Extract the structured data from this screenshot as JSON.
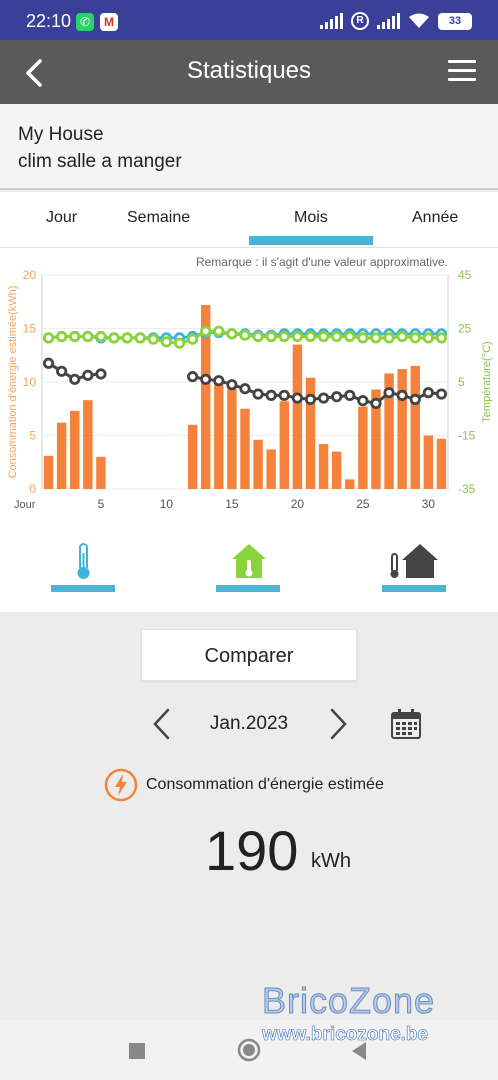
{
  "status_bar": {
    "time": "22:10",
    "battery": "33",
    "apps": [
      "whatsapp-icon",
      "gmail-icon"
    ],
    "indicators": [
      "signal-icon",
      "roaming-icon",
      "signal-icon",
      "wifi-icon",
      "battery-icon"
    ]
  },
  "app_bar": {
    "title": "Statistiques",
    "back_icon": "back-arrow-icon",
    "menu_icon": "hamburger-menu-icon"
  },
  "device": {
    "home": "My House",
    "name": "clim salle a manger"
  },
  "tabs": [
    {
      "label": "Jour",
      "active": false
    },
    {
      "label": "Semaine",
      "active": false
    },
    {
      "label": "Mois",
      "active": true
    },
    {
      "label": "Année",
      "active": false
    }
  ],
  "chart_data": {
    "type": "bar",
    "note": "Remarque : il s'agit d'une valeur approximative.",
    "xlabel": "Jour",
    "ylabel": "Consommation d'énergie estimée(kWh)",
    "y2label": "Température(°C)",
    "ylim": [
      0,
      20
    ],
    "y2lim": [
      -35,
      45
    ],
    "x": [
      1,
      2,
      3,
      4,
      5,
      6,
      7,
      8,
      9,
      10,
      11,
      12,
      13,
      14,
      15,
      16,
      17,
      18,
      19,
      20,
      21,
      22,
      23,
      24,
      25,
      26,
      27,
      28,
      29,
      30,
      31
    ],
    "xticks": [
      5,
      10,
      15,
      20,
      25,
      30
    ],
    "yticks": [
      0,
      5,
      10,
      15,
      20
    ],
    "y2ticks": [
      -35,
      -15,
      5,
      25,
      45
    ],
    "colors": {
      "bars": "#f5823a",
      "axis_left": "#f5a35f",
      "axis_right": "#8bc34a",
      "series_blue": "#3fb3d9",
      "series_green": "#8bd33a",
      "series_dark": "#444444"
    },
    "series": [
      {
        "type": "bar",
        "values": [
          3.1,
          6.2,
          7.3,
          8.3,
          3.0,
          null,
          null,
          null,
          null,
          null,
          null,
          6.0,
          17.2,
          10.3,
          9.4,
          7.5,
          4.6,
          3.7,
          8.2,
          13.5,
          10.4,
          4.2,
          3.5,
          0.9,
          7.7,
          9.3,
          10.8,
          11.2,
          11.5,
          5.0,
          4.7
        ]
      },
      {
        "type": "line",
        "values": [
          21.5,
          22,
          22,
          22,
          21.5,
          21.5,
          21.5,
          21.5,
          21.5,
          21.5,
          21.5,
          22,
          23.5,
          23.5,
          23,
          23,
          22.5,
          22.5,
          23,
          23,
          23,
          23,
          23,
          23,
          23,
          23,
          23,
          23,
          23,
          23,
          23
        ]
      },
      {
        "type": "line",
        "values": [
          21.5,
          22,
          22,
          22,
          22,
          21.5,
          21.5,
          21.5,
          21,
          20,
          19.5,
          21,
          24,
          24,
          23,
          22.5,
          22,
          22,
          22,
          22,
          22,
          22,
          22,
          22,
          21.5,
          21.5,
          21.5,
          22,
          21.5,
          21.5,
          21.5
        ]
      },
      {
        "type": "line",
        "values": [
          12,
          9,
          6,
          7.5,
          8,
          null,
          null,
          null,
          null,
          null,
          null,
          7,
          6,
          5.5,
          4,
          2.5,
          0.5,
          0,
          0,
          -1,
          -1.5,
          -1,
          -0.5,
          0,
          -2,
          -3,
          1,
          0,
          -1.5,
          1,
          0.5
        ]
      }
    ]
  },
  "views": [
    {
      "icon": "thermometer-icon"
    },
    {
      "icon": "house-temperature-icon"
    },
    {
      "icon": "thermometer-house-icon"
    }
  ],
  "compare_label": "Comparer",
  "date": {
    "label": "Jan.2023",
    "prev_icon": "chevron-left-icon",
    "next_icon": "chevron-right-icon",
    "calendar_icon": "calendar-icon"
  },
  "energy": {
    "label": "Consommation d'énergie estimée",
    "value": "190",
    "unit": "kWh",
    "icon": "lightning-icon"
  },
  "watermark": {
    "title": "BricoZone",
    "url": "www.bricozone.be"
  },
  "nav": [
    "recents-button",
    "home-button",
    "back-button"
  ]
}
